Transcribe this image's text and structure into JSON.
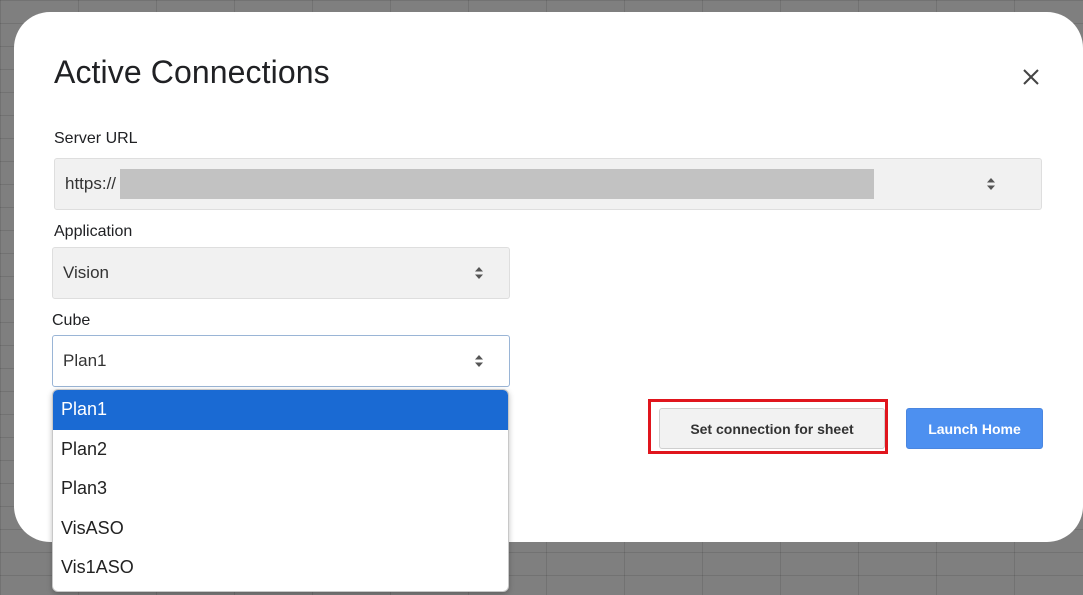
{
  "dialog": {
    "title": "Active Connections",
    "close_icon": "close-icon"
  },
  "server_url": {
    "label": "Server URL",
    "value": "https://"
  },
  "application": {
    "label": "Application",
    "value": "Vision"
  },
  "cube": {
    "label": "Cube",
    "value": "Plan1",
    "options": [
      "Plan1",
      "Plan2",
      "Plan3",
      "VisASO",
      "Vis1ASO"
    ],
    "selected_index": 0
  },
  "buttons": {
    "set_connection": "Set connection for sheet",
    "launch_home": "Launch Home"
  },
  "colors": {
    "accent_blue": "#4d90f0",
    "selected_option": "#1a6ad3",
    "highlight_red": "#e0151d"
  }
}
